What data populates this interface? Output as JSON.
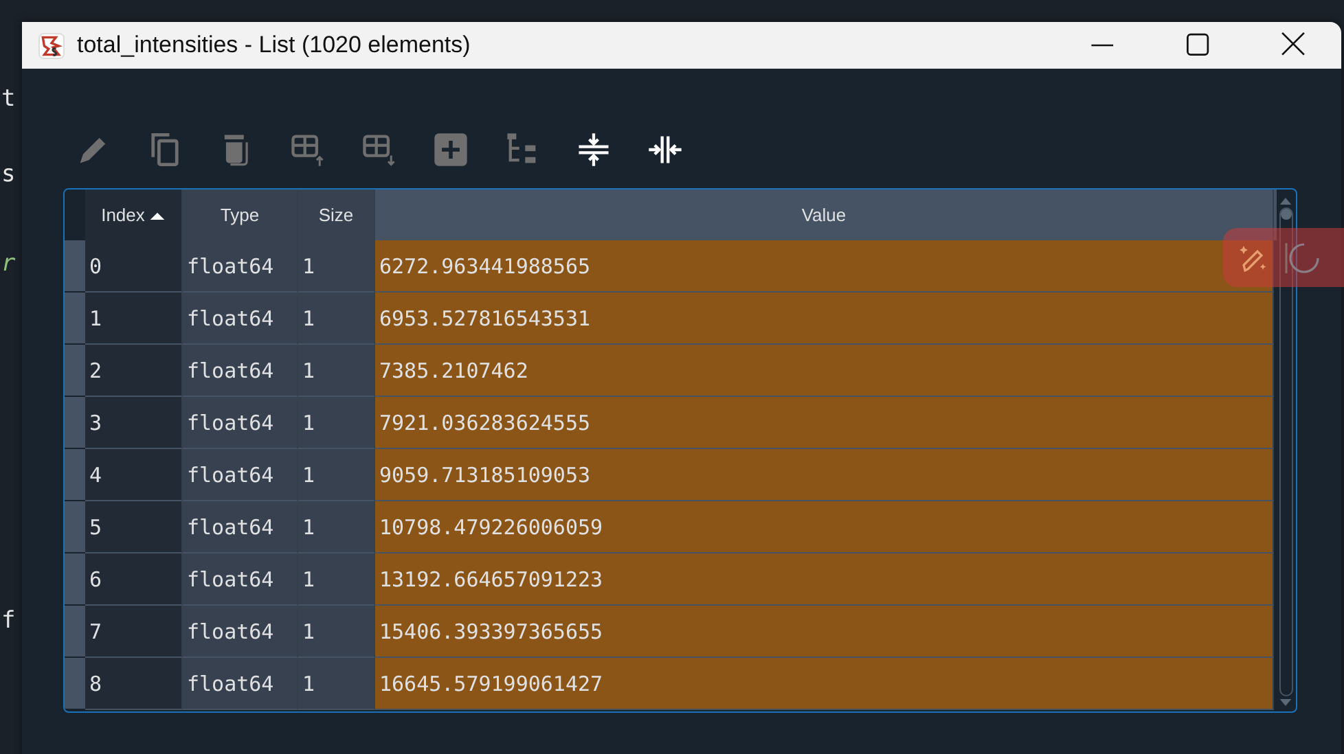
{
  "background_code": [
    {
      "text": "t",
      "kind": "plain"
    },
    {
      "text": "s",
      "kind": "plain"
    },
    {
      "text": "r",
      "kind": "string"
    },
    {
      "text": "f",
      "kind": "plain"
    }
  ],
  "window": {
    "title": "total_intensities - List (1020 elements)"
  },
  "toolbar": [
    {
      "kind": "edit",
      "disabled": true
    },
    {
      "kind": "copy",
      "disabled": true
    },
    {
      "kind": "delete",
      "disabled": true
    },
    {
      "kind": "insert_above",
      "disabled": true
    },
    {
      "kind": "insert_below",
      "disabled": true
    },
    {
      "kind": "add",
      "disabled": true
    },
    {
      "kind": "tree",
      "disabled": true
    },
    {
      "kind": "resize_rows",
      "disabled": false
    },
    {
      "kind": "resize_columns",
      "disabled": false
    }
  ],
  "table": {
    "columns": [
      {
        "label": "Index",
        "sorted": true
      },
      {
        "label": "Type",
        "sorted": false
      },
      {
        "label": "Size",
        "sorted": false
      },
      {
        "label": "Value",
        "sorted": false
      }
    ],
    "rows": [
      {
        "index": "0",
        "type": "float64",
        "size": "1",
        "value": "6272.963441988565"
      },
      {
        "index": "1",
        "type": "float64",
        "size": "1",
        "value": "6953.527816543531"
      },
      {
        "index": "2",
        "type": "float64",
        "size": "1",
        "value": "7385.2107462"
      },
      {
        "index": "3",
        "type": "float64",
        "size": "1",
        "value": "7921.036283624555"
      },
      {
        "index": "4",
        "type": "float64",
        "size": "1",
        "value": "9059.713185109053"
      },
      {
        "index": "5",
        "type": "float64",
        "size": "1",
        "value": "10798.479226006059"
      },
      {
        "index": "6",
        "type": "float64",
        "size": "1",
        "value": "13192.664657091223"
      },
      {
        "index": "7",
        "type": "float64",
        "size": "1",
        "value": "15406.393397365655"
      },
      {
        "index": "8",
        "type": "float64",
        "size": "1",
        "value": "16645.579199061427"
      }
    ]
  }
}
